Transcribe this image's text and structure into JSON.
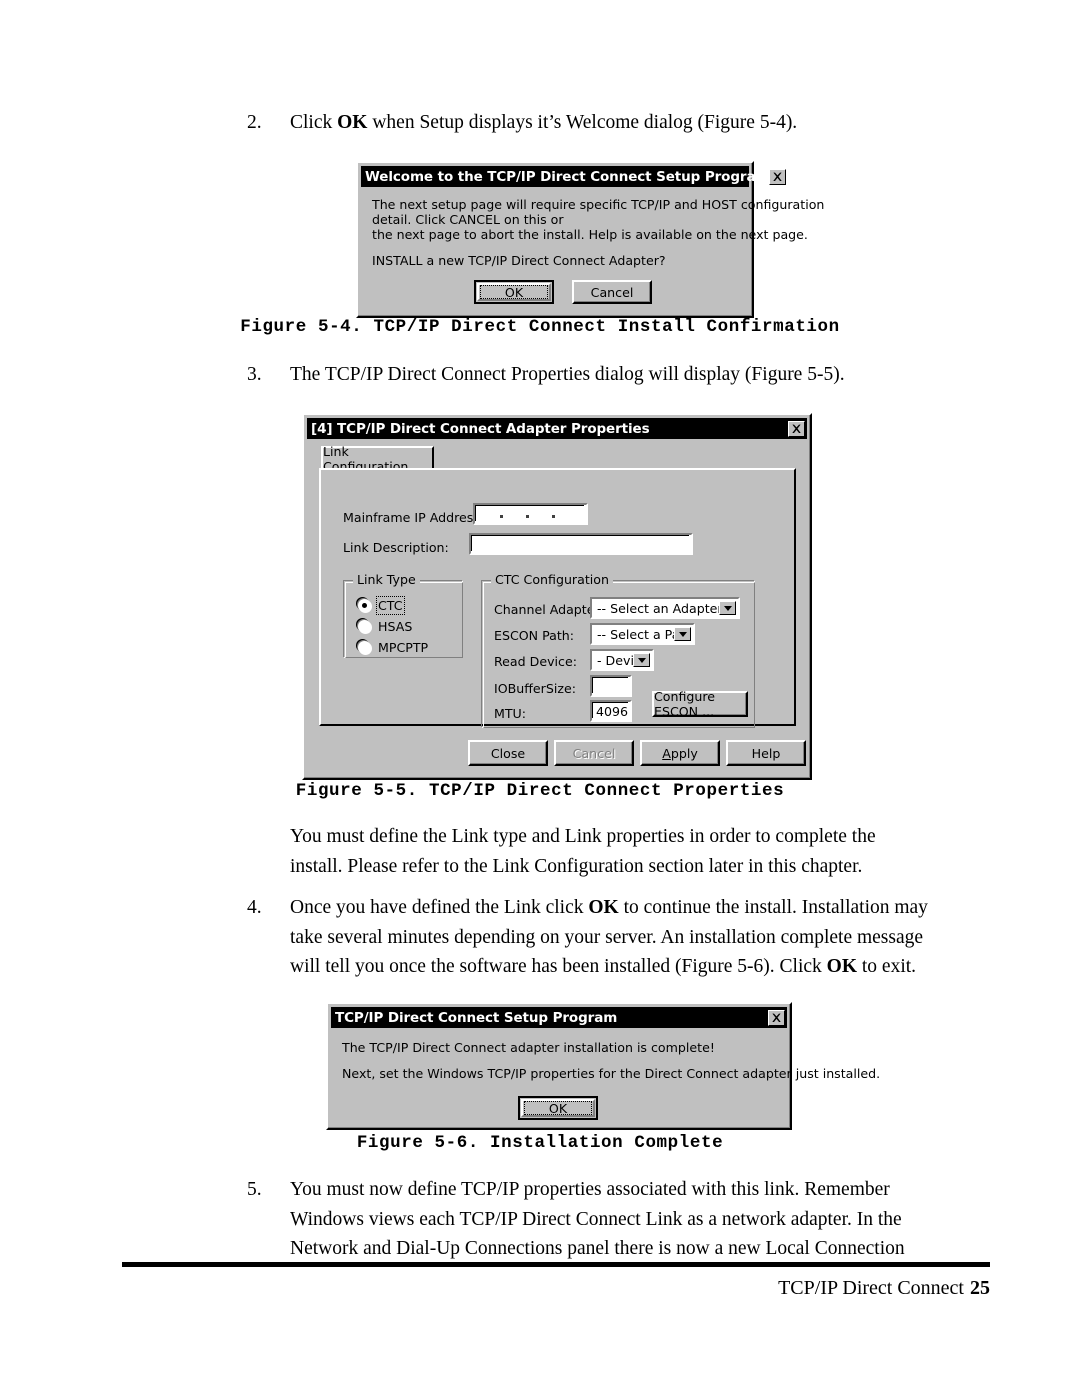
{
  "page": {
    "footer_label": "TCP/IP Direct Connect",
    "page_number": "25"
  },
  "steps": {
    "step2": {
      "num": "2.",
      "text_before": "Click ",
      "bold": "OK",
      "text_after": " when Setup displays it’s Welcome dialog (Figure 5-4)."
    },
    "step3": {
      "num": "3.",
      "text": "The TCP/IP Direct Connect Properties dialog will display (Figure 5-5)."
    },
    "note": {
      "line1": "You must define the Link type and Link properties in order to complete the",
      "line2": "install.  Please refer to the Link Configuration section later in this chapter."
    },
    "step4": {
      "num": "4.",
      "seg1": "Once you have defined the Link click ",
      "bold1": "OK",
      "seg2": " to continue the install.  Installation may",
      "line2": "take several minutes depending on your server.  An installation complete message",
      "seg3": "will tell you once the software has been installed (Figure 5-6).  Click ",
      "bold2": "OK",
      "seg4": " to exit."
    },
    "step5": {
      "num": "5.",
      "line1": "You must now define TCP/IP properties associated with this link.  Remember",
      "line2": "Windows views each TCP/IP Direct Connect Link as a network adapter.  In the",
      "line3": "Network and Dial-Up Connections panel there is now a new Local Connection"
    }
  },
  "captions": {
    "fig54": "Figure 5-4. TCP/IP Direct Connect Install Confirmation",
    "fig55": "Figure 5-5. TCP/IP Direct Connect Properties",
    "fig56": "Figure 5-6. Installation Complete"
  },
  "dialog_welcome": {
    "title": "Welcome to the TCP/IP Direct Connect Setup Program",
    "close_icon": "close-icon",
    "body_line1": "The next setup page will require specific TCP/IP and HOST configuration",
    "body_line2": "detail.  Click CANCEL on this or",
    "body_line3": "the next page to abort the install.  Help is available on the next page.",
    "body_line4": "INSTALL a new TCP/IP Direct Connect Adapter?",
    "ok_label": "OK",
    "cancel_label": "Cancel"
  },
  "dialog_properties": {
    "title": "[4] TCP/IP Direct Connect Adapter Properties",
    "close_icon": "close-icon",
    "tab_label": "Link Configuration",
    "mainframe_ip_label": "Mainframe IP Address:",
    "mainframe_ip_value": "",
    "link_description_label": "Link Description:",
    "link_description_value": "",
    "link_type": {
      "group_label": "Link Type",
      "options": [
        {
          "label": "CTC",
          "selected": true
        },
        {
          "label": "HSAS",
          "selected": false
        },
        {
          "label": "MPCPTP",
          "selected": false
        }
      ]
    },
    "ctc": {
      "group_label": "CTC Configuration",
      "channel_adapter_label": "Channel Adapter:",
      "channel_adapter_value": "-- Select an Adapter --",
      "escon_path_label": "ESCON Path:",
      "escon_path_value": "-- Select a Path --",
      "read_device_label": "Read Device:",
      "read_device_value": "- Device ?",
      "iobuffersize_label": "IOBufferSize:",
      "iobuffersize_value": "",
      "mtu_label": "MTU:",
      "mtu_value": "4096",
      "configure_escon_label": "Configure ESCON ..."
    },
    "buttons": {
      "close": "Close",
      "cancel": "Cancel",
      "apply_prefix": "A",
      "apply_rest": "pply",
      "help": "Help"
    }
  },
  "dialog_complete": {
    "title": "TCP/IP Direct Connect Setup Program",
    "close_icon": "close-icon",
    "body_line1": "The TCP/IP Direct Connect adapter installation is complete!",
    "body_line2": "Next, set the Windows TCP/IP properties for the Direct Connect adapter just installed.",
    "ok_label": "OK"
  }
}
